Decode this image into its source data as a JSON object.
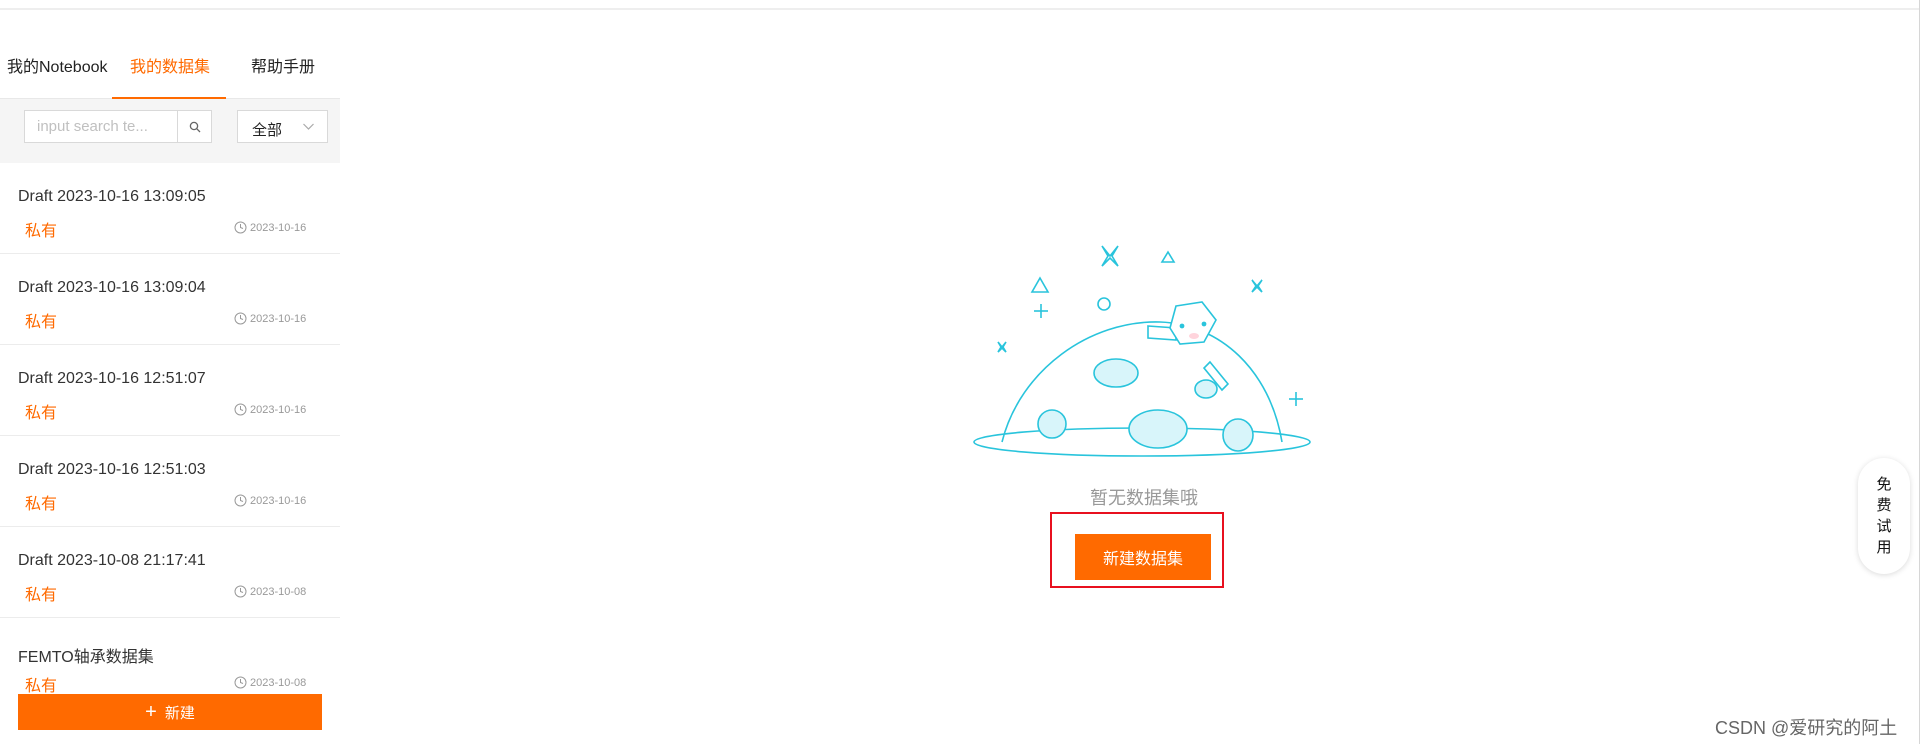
{
  "tabs": [
    {
      "label": "我的Notebook",
      "active": false
    },
    {
      "label": "我的数据集",
      "active": true
    },
    {
      "label": "帮助手册",
      "active": false
    }
  ],
  "search": {
    "placeholder": "input search te...",
    "value": ""
  },
  "filter": {
    "selected": "全部"
  },
  "items": [
    {
      "title": "Draft 2023-10-16 13:09:05",
      "tag": "私有",
      "date": "2023-10-16"
    },
    {
      "title": "Draft 2023-10-16 13:09:04",
      "tag": "私有",
      "date": "2023-10-16"
    },
    {
      "title": "Draft 2023-10-16 12:51:07",
      "tag": "私有",
      "date": "2023-10-16"
    },
    {
      "title": "Draft 2023-10-16 12:51:03",
      "tag": "私有",
      "date": "2023-10-16"
    },
    {
      "title": "Draft 2023-10-08 21:17:41",
      "tag": "私有",
      "date": "2023-10-08"
    },
    {
      "title": "FEMTO轴承数据集",
      "tag": "私有",
      "date": "2023-10-08"
    }
  ],
  "new_button": {
    "label": "新建"
  },
  "empty_state": {
    "text": "暂无数据集哦",
    "button_label": "新建数据集"
  },
  "trial": {
    "chars": [
      "免",
      "费",
      "试",
      "用"
    ]
  },
  "watermark": "CSDN @爱研究的阿土",
  "colors": {
    "accent": "#ff6a00",
    "highlight": "#e8101f",
    "illustration": "#29c4dc"
  },
  "icons": [
    "search-icon",
    "chevron-down-icon",
    "clock-icon",
    "plus-icon"
  ]
}
